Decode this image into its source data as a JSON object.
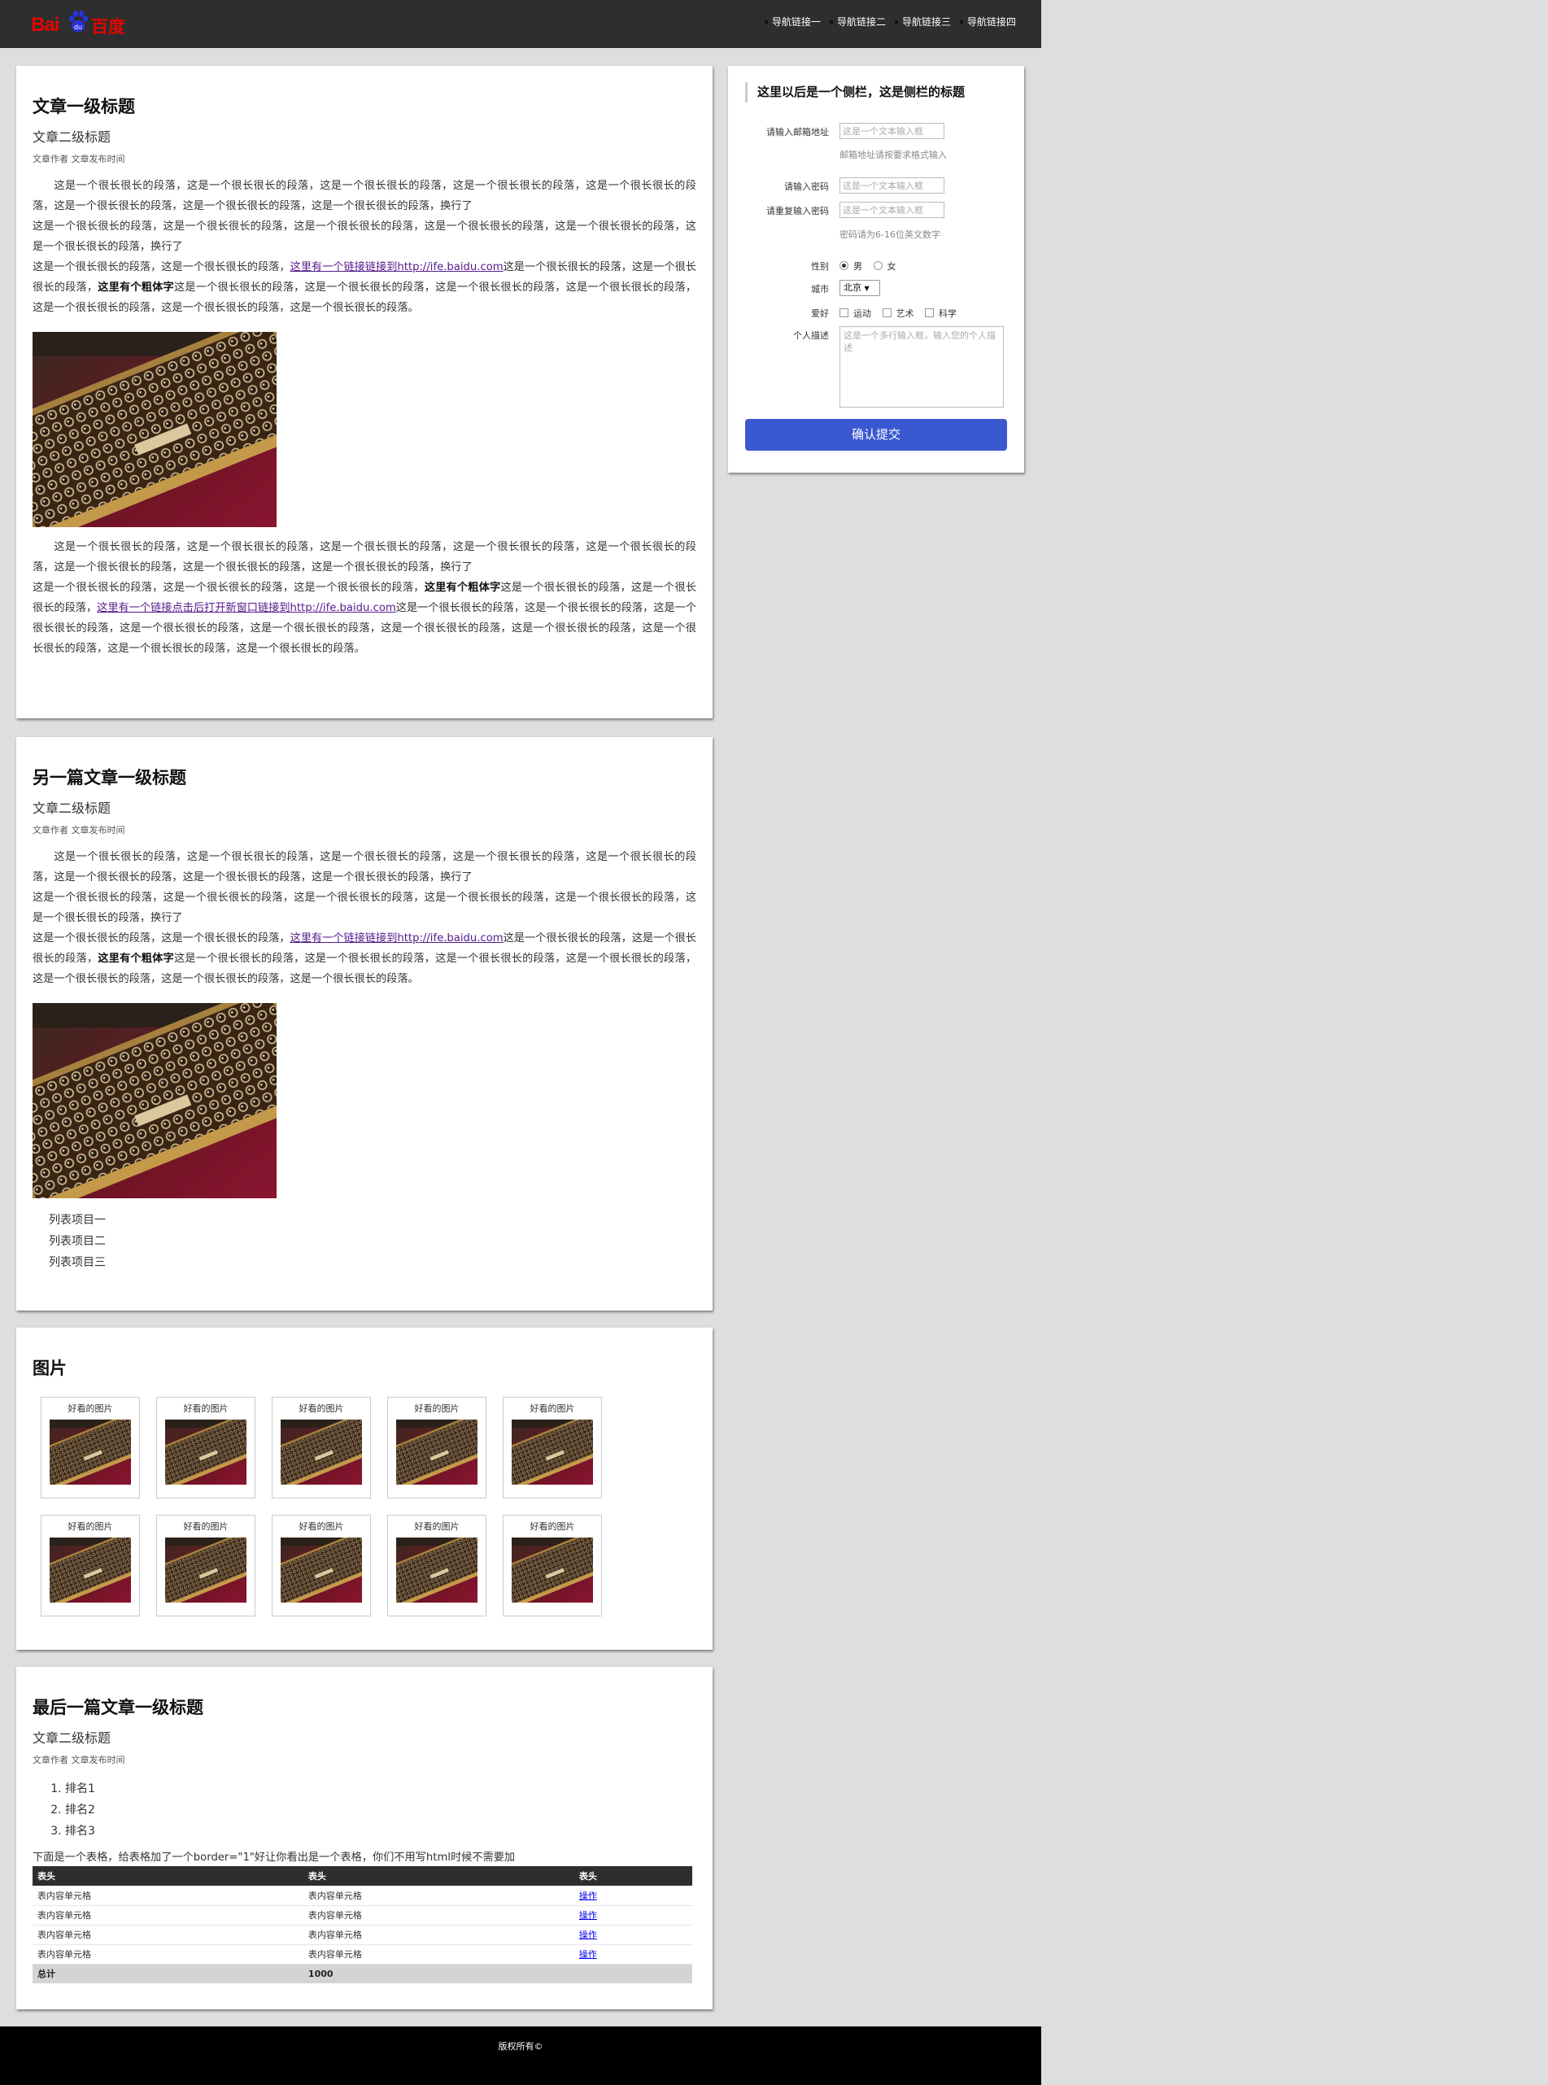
{
  "header": {
    "logo_text_left": "Bai",
    "logo_text_right": "百度",
    "nav": [
      "导航链接一",
      "导航链接二",
      "导航链接三",
      "导航链接四"
    ]
  },
  "article1": {
    "h1": "文章一级标题",
    "h2": "文章二级标题",
    "meta": "文章作者 文章发布时间",
    "p1a": "这是一个很长很长的段落，这是一个很长很长的段落，这是一个很长很长的段落，这是一个很长很长的段落，这是一个很长很长的段落，这是一个很长很长的段落，这是一个很长很长的段落，这是一个很长很长的段落，换行了",
    "p1b": "这是一个很长很长的段落，这是一个很长很长的段落，这是一个很长很长的段落，这是一个很长很长的段落，这是一个很长很长的段落，这是一个很长很长的段落，换行了",
    "p1c_pre": "这是一个很长很长的段落，这是一个很长很长的段落，",
    "p1c_link": "这里有一个链接链接到http://ife.baidu.com",
    "p1c_mid": "这是一个很长很长的段落，这是一个很长很长的段落，",
    "p1c_bold": "这里有个粗体字",
    "p1c_post": "这是一个很长很长的段落，这是一个很长很长的段落，这是一个很长很长的段落，这是一个很长很长的段落，这是一个很长很长的段落，这是一个很长很长的段落，这是一个很长很长的段落。",
    "p2a": "这是一个很长很长的段落，这是一个很长很长的段落，这是一个很长很长的段落，这是一个很长很长的段落，这是一个很长很长的段落，这是一个很长很长的段落，这是一个很长很长的段落，这是一个很长很长的段落，换行了",
    "p2b_pre": "这是一个很长很长的段落，这是一个很长很长的段落，这是一个很长很长的段落，",
    "p2b_bold": "这里有个粗体字",
    "p2b_mid": "这是一个很长很长的段落，这是一个很长很长的段落，",
    "p2b_link": "这里有一个链接点击后打开新窗口链接到http://ife.baidu.com",
    "p2b_post": "这是一个很长很长的段落，这是一个很长很长的段落，这是一个很长很长的段落，这是一个很长很长的段落，这是一个很长很长的段落，这是一个很长很长的段落，这是一个很长很长的段落，这是一个很长很长的段落，这是一个很长很长的段落，这是一个很长很长的段落。"
  },
  "article2": {
    "h1": "另一篇文章一级标题",
    "h2": "文章二级标题",
    "meta": "文章作者 文章发布时间",
    "list": [
      "列表项目一",
      "列表项目二",
      "列表项目三"
    ]
  },
  "gallery": {
    "h1": "图片",
    "caption": "好看的图片"
  },
  "article3": {
    "h1": "最后一篇文章一级标题",
    "h2": "文章二级标题",
    "meta": "文章作者 文章发布时间",
    "ranks": [
      "排名1",
      "排名2",
      "排名3"
    ],
    "table_caption": "下面是一个表格，给表格加了一个border=\"1\"好让你看出是一个表格，你们不用写html时候不需要加",
    "table": {
      "headers": [
        "表头",
        "表头",
        "表头"
      ],
      "cell": "表内容单元格",
      "action": "操作",
      "total_label": "总计",
      "total_value": "1000"
    }
  },
  "sidebar": {
    "title": "这里以后是一个侧栏，这是侧栏的标题",
    "email_label": "请输入邮箱地址",
    "email_placeholder": "这是一个文本输入框",
    "email_hint": "邮箱地址请按要求格式输入",
    "password_label": "请输入密码",
    "password_placeholder": "这是一个文本输入框",
    "repeat_label": "请重复输入密码",
    "repeat_placeholder": "这是一个文本输入框",
    "password_hint": "密码请为6-16位英文数字",
    "gender_label": "性别",
    "gender_male": "男",
    "gender_female": "女",
    "city_label": "城市",
    "city_value": "北京",
    "hobby_label": "爱好",
    "hobbies": [
      "运动",
      "艺术",
      "科学"
    ],
    "desc_label": "个人描述",
    "desc_placeholder": "这是一个多行输入框，输入您的个人描述",
    "submit": "确认提交"
  },
  "footer": {
    "text": "版权所有©"
  }
}
